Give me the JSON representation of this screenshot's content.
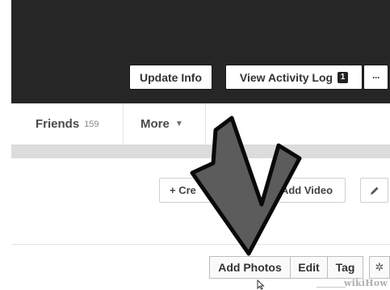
{
  "cover": {
    "update_info_label": "Update Info",
    "activity_log_label": "View Activity Log",
    "activity_log_badge": "1",
    "more_options_label": "···"
  },
  "tabs": {
    "friends_label": "Friends",
    "friends_count": "159",
    "more_label": "More",
    "more_caret": "▼"
  },
  "panel": {
    "create_label": "+ Cre",
    "add_video_label": "Add Video",
    "edit_icon": "pencil-icon"
  },
  "photo_actions": {
    "add_photos_label": "Add Photos",
    "edit_label": "Edit",
    "tag_label": "Tag",
    "settings_icon": "gear-icon"
  },
  "watermark": "wikiHow",
  "colors": {
    "cover": "#262626",
    "arrow": "#5c5c5c",
    "separator_band": "#dcdcdc"
  }
}
